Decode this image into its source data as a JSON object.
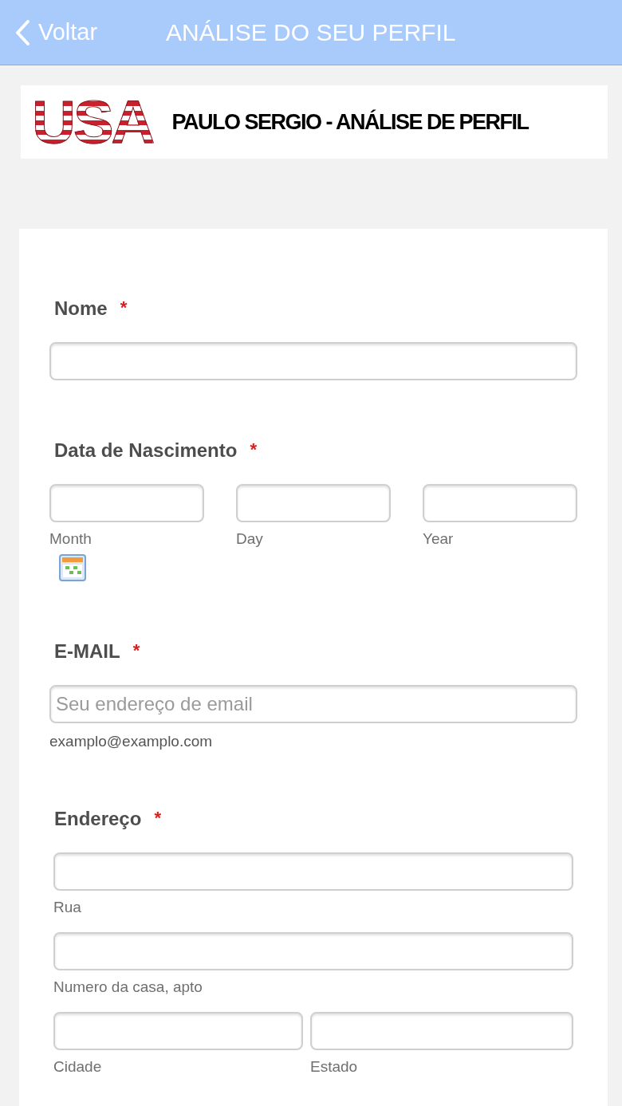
{
  "nav_bar": {
    "back_label": "Voltar",
    "title": "ANÁLISE DO SEU PERFIL"
  },
  "banner": {
    "logo_text": "USA",
    "heading": "PAULO SERGIO - ANÁLISE DE PERFIL"
  },
  "form": {
    "fields": [
      {
        "kind": "text",
        "label": "Nome",
        "required_mark": "*"
      },
      {
        "kind": "date",
        "label": "Data de Nascimento",
        "required_mark": "*",
        "inputs": [
          {
            "sublabel": "Month"
          },
          {
            "sublabel": "Day"
          },
          {
            "sublabel": "Year"
          }
        ]
      },
      {
        "kind": "email",
        "label": "E-MAIL",
        "required_mark": "*",
        "inputs": [
          {
            "placeholder": "Seu endereço de email"
          }
        ],
        "hint": "examplo@examplo.com"
      },
      {
        "kind": "address",
        "label": "Endereço",
        "required_mark": "*",
        "inputs": [
          {
            "sublabel": "Rua"
          },
          {
            "sublabel": "Numero da casa, apto"
          }
        ],
        "pair": [
          {
            "sublabel": "Cidade"
          },
          {
            "sublabel": "Estado"
          }
        ]
      }
    ]
  }
}
